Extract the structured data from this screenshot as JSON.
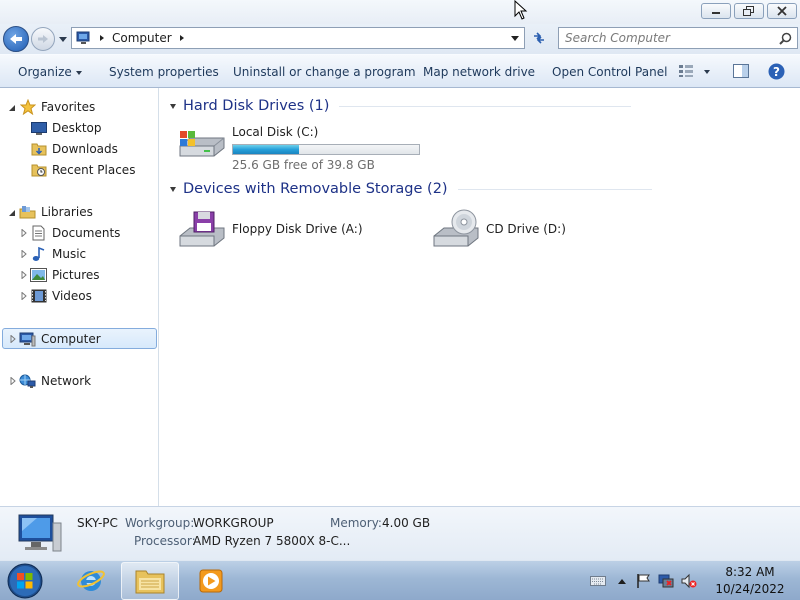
{
  "window": {
    "address": {
      "crumb": "Computer"
    },
    "search": {
      "placeholder": "Search Computer"
    }
  },
  "toolbar": {
    "organize": "Organize",
    "system_properties": "System properties",
    "uninstall": "Uninstall or change a program",
    "map_drive": "Map network drive",
    "control_panel": "Open Control Panel"
  },
  "nav": {
    "favorites": "Favorites",
    "desktop": "Desktop",
    "downloads": "Downloads",
    "recent": "Recent Places",
    "libraries": "Libraries",
    "documents": "Documents",
    "music": "Music",
    "pictures": "Pictures",
    "videos": "Videos",
    "computer": "Computer",
    "network": "Network"
  },
  "content": {
    "hdd_group": "Hard Disk Drives (1)",
    "removable_group": "Devices with Removable Storage (2)",
    "local_disk": {
      "name": "Local Disk (C:)",
      "free": "25.6 GB free of 39.8 GB",
      "used_fraction": 0.357
    },
    "floppy": "Floppy Disk Drive (A:)",
    "cd": "CD Drive (D:)"
  },
  "details": {
    "name": "SKY-PC",
    "workgroup_label": "Workgroup:",
    "workgroup": "WORKGROUP",
    "memory_label": "Memory:",
    "memory": "4.00 GB",
    "processor_label": "Processor:",
    "processor": "AMD Ryzen 7 5800X 8-C..."
  },
  "taskbar": {
    "time": "8:32 AM",
    "date": "10/24/2022"
  }
}
